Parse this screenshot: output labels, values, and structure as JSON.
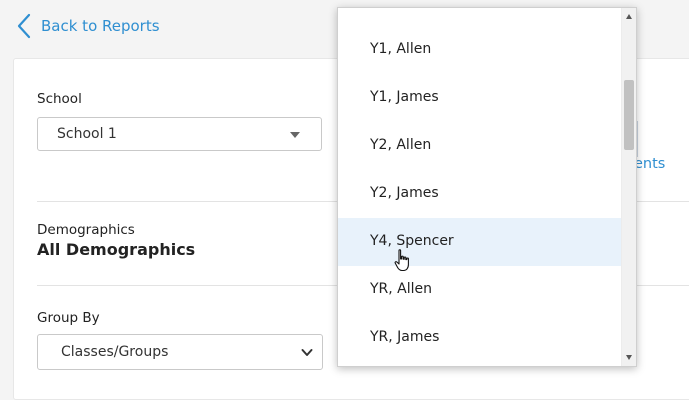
{
  "nav": {
    "back_label": "Back to Reports"
  },
  "form": {
    "school_label": "School",
    "school_value": "School 1",
    "demographics_label": "Demographics",
    "demographics_value": "All Demographics",
    "group_by_label": "Group By",
    "group_by_value": "Classes/Groups"
  },
  "right_panel": {
    "link_fragment": "ents"
  },
  "dropdown": {
    "items": [
      {
        "label": "Y1, Allen",
        "highlighted": false
      },
      {
        "label": "Y1, James",
        "highlighted": false
      },
      {
        "label": "Y2, Allen",
        "highlighted": false
      },
      {
        "label": "Y2, James",
        "highlighted": false
      },
      {
        "label": "Y4, Spencer",
        "highlighted": true
      },
      {
        "label": "YR, Allen",
        "highlighted": false
      },
      {
        "label": "YR, James",
        "highlighted": false
      }
    ],
    "highlight_color": "#e8f2fb"
  },
  "colors": {
    "link": "#2f8fd1"
  },
  "icons": {
    "back": "chevron-left-icon",
    "cursor": "hand-pointer-icon"
  }
}
